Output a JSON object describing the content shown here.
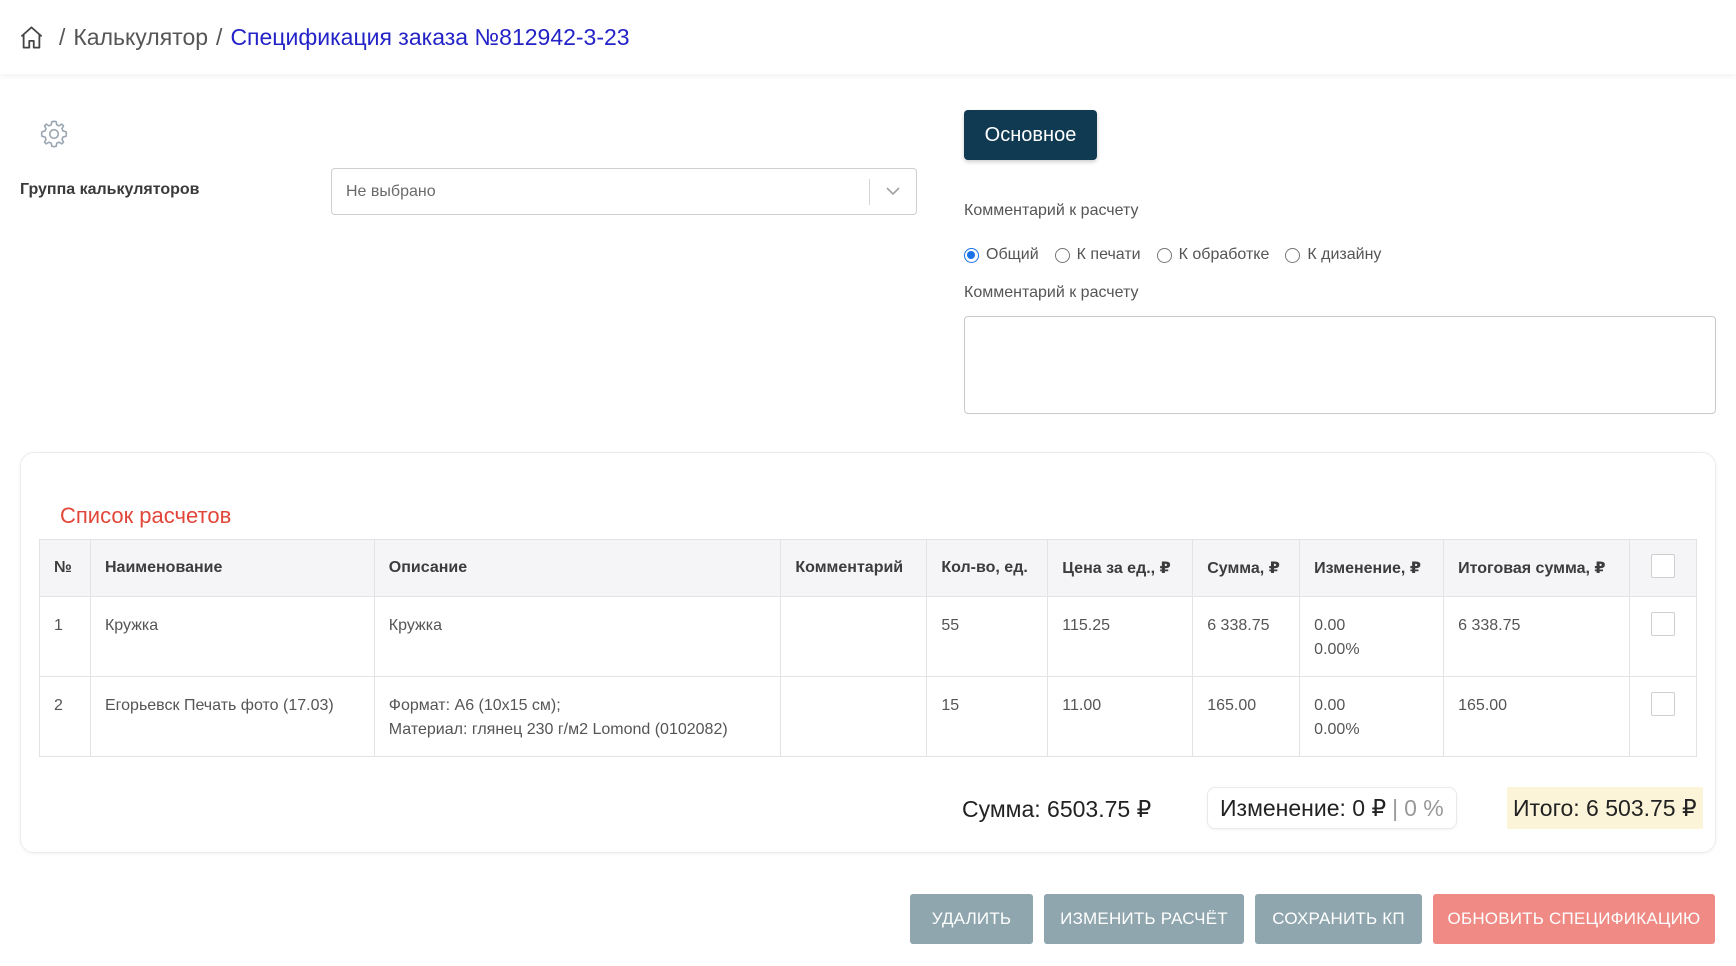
{
  "breadcrumb": {
    "sep1": "/",
    "calculator": "Калькулятор",
    "sep2": "/",
    "current": "Спецификация заказа №812942-3-23"
  },
  "left": {
    "group_label": "Группа калькуляторов",
    "group_select_value": "Не выбрано"
  },
  "right": {
    "tab_main": "Основное",
    "comment_label_1": "Комментарий к расчету",
    "radio_options": [
      "Общий",
      "К печати",
      "К обработке",
      "К дизайну"
    ],
    "radio_selected": "Общий",
    "comment_label_2": "Комментарий к расчету",
    "comment_value": ""
  },
  "calc_list": {
    "title": "Список расчетов",
    "headers": [
      "№",
      "Наименование",
      "Описание",
      "Комментарий",
      "Кол-во, ед.",
      "Цена за ед., ₽",
      "Сумма, ₽",
      "Изменение, ₽",
      "Итоговая сумма, ₽"
    ],
    "rows": [
      {
        "num": "1",
        "name": "Кружка",
        "desc1": "Кружка",
        "desc2": "",
        "comment": "",
        "qty": "55",
        "price": "115.25",
        "sum": "6 338.75",
        "change1": "0.00",
        "change2": "0.00%",
        "total": "6 338.75"
      },
      {
        "num": "2",
        "name": "Егорьевск Печать фото (17.03)",
        "desc1": "Формат: А6 (10x15 см);",
        "desc2": "Материал: глянец 230 г/м2 Lomond (0102082)",
        "comment": "",
        "qty": "15",
        "price": "11.00",
        "sum": "165.00",
        "change1": "0.00",
        "change2": "0.00%",
        "total": "165.00"
      }
    ],
    "summary": {
      "sum_text": "Сумма: 6503.75 ₽",
      "change_text": "Изменение: 0 ₽",
      "change_sep": "|",
      "change_percent": "0 %",
      "total_text": "Итого: 6 503.75 ₽"
    }
  },
  "actions": {
    "delete": "УДАЛИТЬ",
    "edit": "ИЗМЕНИТЬ РАСЧЁТ",
    "save_kp": "СОХРАНИТЬ КП",
    "update_spec": "ОБНОВИТЬ СПЕЦИФИКАЦИЮ"
  },
  "colors": {
    "accent_dark": "#0f3a52",
    "link_blue": "#2323c8",
    "title_red": "#e2463a",
    "button_grey": "#8fa6ae",
    "button_red": "#ef8a85",
    "total_highlight": "#fbf4d8"
  }
}
